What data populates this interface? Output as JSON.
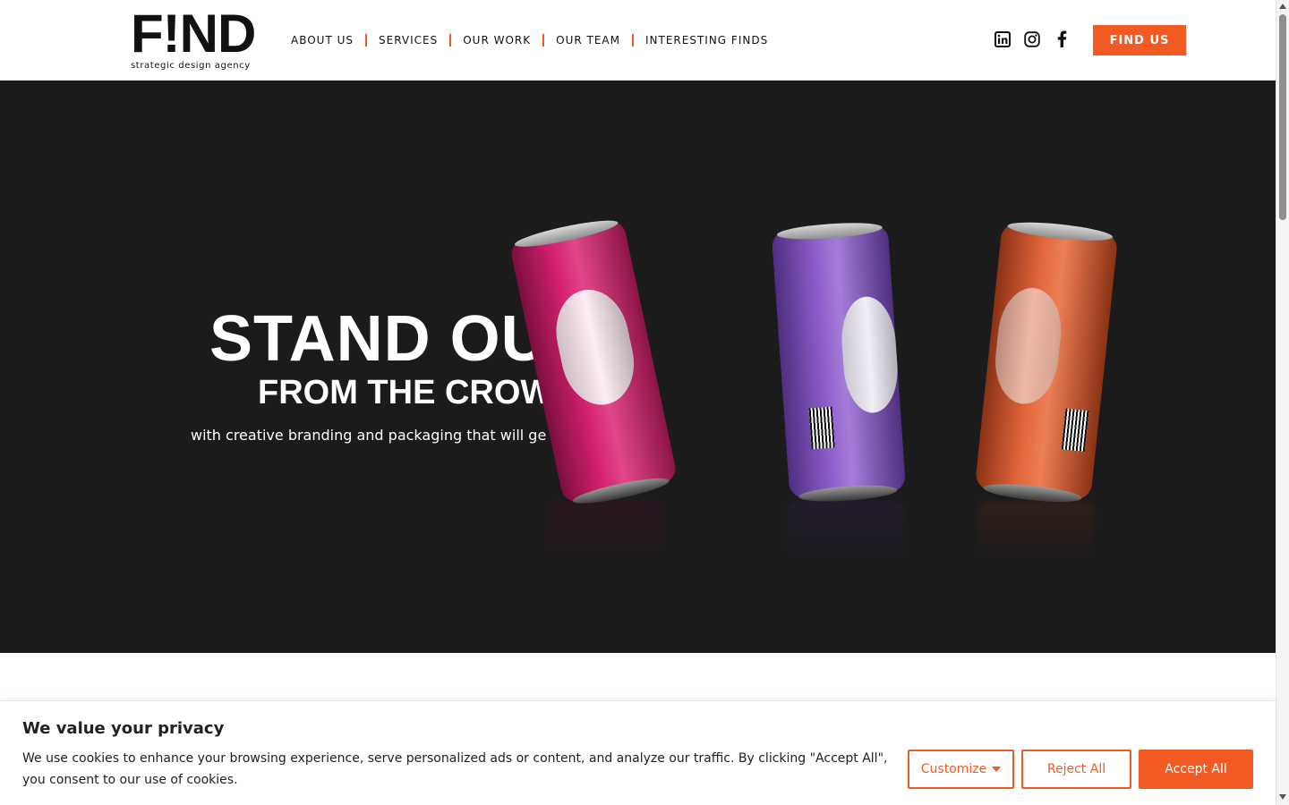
{
  "header": {
    "logo_text": "F!ND",
    "logo_tagline": "strategic design agency",
    "nav": [
      {
        "label": "ABOUT US"
      },
      {
        "label": "SERVICES"
      },
      {
        "label": "OUR WORK"
      },
      {
        "label": "OUR TEAM"
      },
      {
        "label": "INTERESTING FINDS"
      }
    ],
    "socials": [
      "linkedin-icon",
      "instagram-icon",
      "facebook-icon"
    ],
    "cta_label": "FIND US"
  },
  "hero": {
    "title": "STAND OUT",
    "subtitle": "FROM THE CROWD",
    "copy": "with creative branding and packaging that will get you noticed",
    "can_colors": [
      "#d4206e",
      "#8b5cc9",
      "#e0643a"
    ]
  },
  "cookie": {
    "title": "We value your privacy",
    "text": "We use cookies to enhance your browsing experience, serve personalized ads or content, and analyze our traffic. By clicking \"Accept All\", you consent to our use of cookies.",
    "customize_label": "Customize",
    "reject_label": "Reject All",
    "accept_label": "Accept All"
  },
  "colors": {
    "accent": "#f15a22",
    "hero_bg": "#1b1b1c"
  }
}
